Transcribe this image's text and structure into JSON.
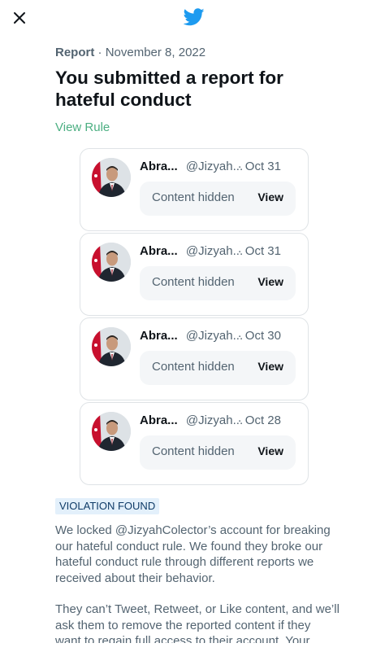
{
  "header": {
    "close_icon": "close-icon",
    "logo_icon": "twitter-bird-icon",
    "brand_color": "#1d9bf0"
  },
  "report": {
    "type": "Report",
    "separator": "·",
    "date": "November 8, 2022",
    "title": "You submitted a report for hateful conduct",
    "view_rule": "View Rule"
  },
  "tweets": [
    {
      "name": "Abra...",
      "handle": "@Jizyah...",
      "date": "· Oct 31",
      "hidden_label": "Content hidden",
      "view_label": "View"
    },
    {
      "name": "Abra...",
      "handle": "@Jizyah...",
      "date": "· Oct 31",
      "hidden_label": "Content hidden",
      "view_label": "View"
    },
    {
      "name": "Abra...",
      "handle": "@Jizyah...",
      "date": "· Oct 30",
      "hidden_label": "Content hidden",
      "view_label": "View"
    },
    {
      "name": "Abra...",
      "handle": "@Jizyah...",
      "date": "· Oct 28",
      "hidden_label": "Content hidden",
      "view_label": "View"
    }
  ],
  "verdict": {
    "badge": "VIOLATION FOUND",
    "paragraph1": "We locked @JizyahColector’s account for breaking our hateful conduct rule. We found they broke our hateful conduct rule through different reports we received about their behavior.",
    "paragraph2": "They can’t Tweet, Retweet, or Like content, and we’ll ask them to remove the reported content if they want to regain full access to their account. Your safety is"
  },
  "colors": {
    "link_green": "#4caf82",
    "badge_bg": "#e3f0fb",
    "muted_text": "#536471"
  }
}
